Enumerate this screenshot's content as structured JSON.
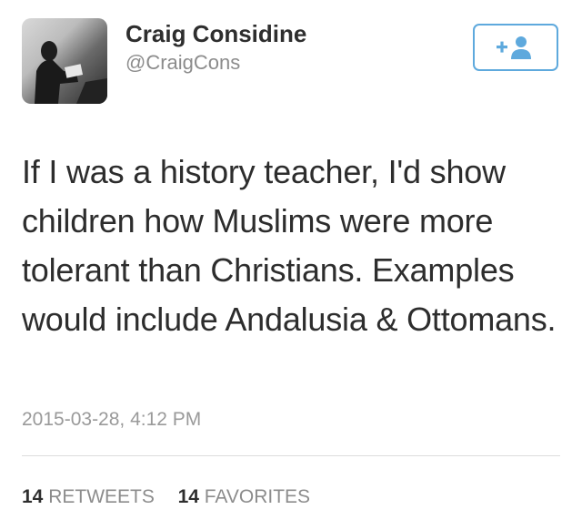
{
  "user": {
    "name": "Craig Considine",
    "handle": "@CraigCons"
  },
  "follow_button": {
    "icon": "add-user-icon",
    "accent": "#5ea9dd"
  },
  "tweet": {
    "text": "If I was a history teacher, I'd show children how Muslims were more tolerant than Christians. Examples would include Andalusia & Ottomans.",
    "timestamp": "2015-03-28, 4:12 PM"
  },
  "stats": {
    "retweets_count": "14",
    "retweets_label": "RETWEETS",
    "favorites_count": "14",
    "favorites_label": "FAVORITES"
  }
}
